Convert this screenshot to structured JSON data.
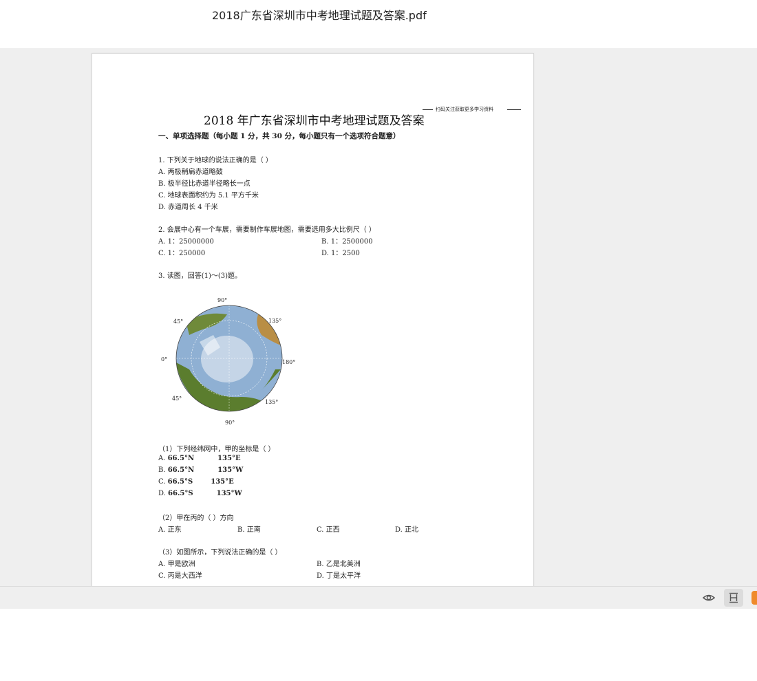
{
  "window": {
    "file_title": "2018广东省深圳市中考地理试题及答案.pdf"
  },
  "document": {
    "watermark": "扫码关注获取更多学习资料",
    "title": "2018 年广东省深圳市中考地理试题及答案",
    "section": "一、单项选择题（每小题 1 分，共 30 分，每小题只有一个选项符合题意）",
    "q1": {
      "stem": "1.   下列关于地球的说法正确的是（              ）",
      "a": "A. 两极稍扁赤道略鼓",
      "b": "B. 极半径比赤道半径略长一点",
      "c": "C. 地球表面积约为 5.1 平方千米",
      "d": "D. 赤道周长 4 千米"
    },
    "q2": {
      "stem": "2.   会展中心有一个车展，需要制作车展地图，需要选用多大比例尺（ ）",
      "a": "A. 1：25000000",
      "b": "B. 1：2500000",
      "c": "C. 1：250000",
      "d": "D. 1：2500"
    },
    "q3": {
      "stem": "3.  读图，回答(1)～(3)题。"
    },
    "globe": {
      "top": "90°",
      "bottom": "90°",
      "left": "0°",
      "right": "180°",
      "ul": "45°",
      "ur": "135°",
      "ll": "45°",
      "lr": "135°",
      "colors": {
        "ocean": "#8fb0d3",
        "land": "#5b7d2e",
        "desert": "#c9a45a",
        "ice": "#dbe6ef"
      }
    },
    "sub1": {
      "stem": "（1）下列经纬网中，甲的坐标是（ ）",
      "a_prefix": "A. ",
      "a_lat": "66.5°N",
      "a_lon": "135°E",
      "b_prefix": "B. ",
      "b_lat": "66.5°N",
      "b_lon": "135°W",
      "c_prefix": "C. ",
      "c_lat": "66.5°S",
      "c_lon": "135°E",
      "d_prefix": "D. ",
      "d_lat": "66.5°S",
      "d_lon": "135°W"
    },
    "sub2": {
      "stem": "（2）甲在丙的（ ）方向",
      "a": "A. 正东",
      "b": "B. 正南",
      "c": "C. 正西",
      "d": "D. 正北"
    },
    "sub3": {
      "stem": "（3）如图所示，下列说法正确的是（ ）",
      "a": "A. 甲是欧洲",
      "b": "B. 乙是北美洲",
      "c": "C. 丙是大西洋",
      "d": "D. 丁是太平洋"
    }
  },
  "toolbar": {
    "accent": "#ef8a2c"
  }
}
